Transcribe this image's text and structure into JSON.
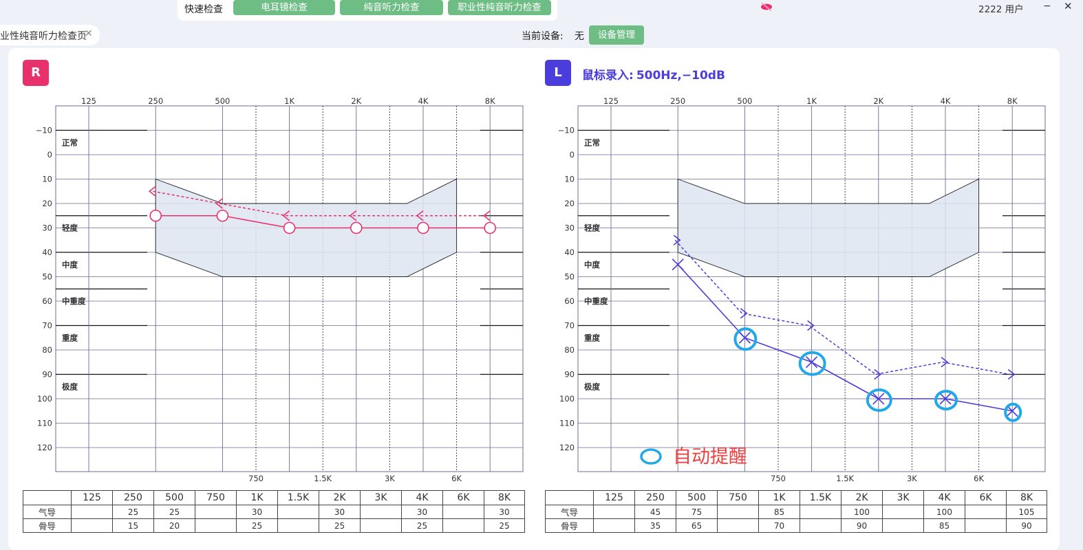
{
  "topbar": {
    "quick_label": "快速检查",
    "buttons": [
      "电耳镜检查",
      "纯音听力检查",
      "职业性纯音听力检查"
    ],
    "user": "2222 用户",
    "minimize": "−",
    "close": "✕"
  },
  "tab": {
    "label": "业性纯音听力检查页",
    "close": "✕"
  },
  "device": {
    "label": "当前设备:",
    "value": "无",
    "button": "设备管理"
  },
  "mouse_entry": {
    "label": "鼠标录入:",
    "value": "500Hz,−10dB"
  },
  "colors": {
    "right": "#e8306c",
    "left": "#4a3ddb",
    "highlight": "#22a8e8",
    "green": "#6dbd85"
  },
  "reminder": {
    "label": "自动提醒"
  },
  "table": {
    "headers": [
      "125",
      "250",
      "500",
      "750",
      "1K",
      "1.5K",
      "2K",
      "3K",
      "4K",
      "6K",
      "8K"
    ],
    "row_labels": [
      "气导",
      "骨导"
    ]
  },
  "chart_data": [
    {
      "type": "line",
      "ear": "R",
      "x_top_labels": [
        "125",
        "250",
        "500",
        "1K",
        "2K",
        "4K",
        "8K"
      ],
      "x_bottom_labels": [
        "750",
        "1.5K",
        "3K",
        "6K"
      ],
      "y_ticks": [
        -10,
        0,
        10,
        20,
        30,
        40,
        50,
        60,
        70,
        80,
        90,
        100,
        110,
        120
      ],
      "ylim": [
        -20,
        130
      ],
      "category_labels": [
        "正常",
        "轻度",
        "中度",
        "中重度",
        "重度",
        "极度"
      ],
      "series": [
        {
          "name": "气导",
          "x": [
            "250",
            "500",
            "1K",
            "2K",
            "4K",
            "8K"
          ],
          "values": [
            25,
            25,
            30,
            30,
            30,
            30
          ]
        },
        {
          "name": "骨导",
          "x": [
            "250",
            "500",
            "1K",
            "2K",
            "4K",
            "8K"
          ],
          "values": [
            15,
            20,
            25,
            25,
            25,
            25
          ]
        }
      ],
      "table": {
        "air": [
          "",
          "25",
          "25",
          "",
          "30",
          "",
          "30",
          "",
          "30",
          "",
          "30"
        ],
        "bone": [
          "",
          "15",
          "20",
          "",
          "25",
          "",
          "25",
          "",
          "25",
          "",
          "25"
        ]
      }
    },
    {
      "type": "line",
      "ear": "L",
      "x_top_labels": [
        "125",
        "250",
        "500",
        "1K",
        "2K",
        "4K",
        "8K"
      ],
      "x_bottom_labels": [
        "750",
        "1.5K",
        "3K",
        "6K"
      ],
      "y_ticks": [
        -10,
        0,
        10,
        20,
        30,
        40,
        50,
        60,
        70,
        80,
        90,
        100,
        110,
        120
      ],
      "ylim": [
        -20,
        130
      ],
      "category_labels": [
        "正常",
        "轻度",
        "中度",
        "中重度",
        "重度",
        "极度"
      ],
      "series": [
        {
          "name": "气导",
          "x": [
            "250",
            "500",
            "1K",
            "2K",
            "4K",
            "8K"
          ],
          "values": [
            45,
            75,
            85,
            100,
            100,
            105
          ]
        },
        {
          "name": "骨导",
          "x": [
            "250",
            "500",
            "1K",
            "2K",
            "4K",
            "8K"
          ],
          "values": [
            35,
            65,
            70,
            90,
            85,
            90
          ]
        }
      ],
      "highlighted": [
        "500",
        "1K",
        "2K",
        "4K",
        "8K"
      ],
      "table": {
        "air": [
          "",
          "45",
          "75",
          "",
          "85",
          "",
          "100",
          "",
          "100",
          "",
          "105"
        ],
        "bone": [
          "",
          "35",
          "65",
          "",
          "70",
          "",
          "90",
          "",
          "85",
          "",
          "90"
        ]
      }
    }
  ]
}
